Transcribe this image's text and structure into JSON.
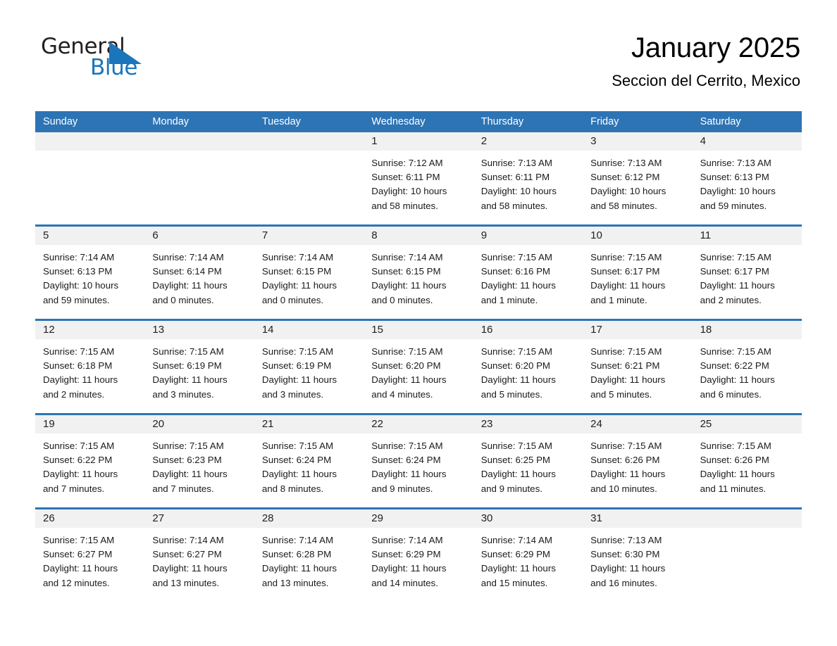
{
  "brand": {
    "name_part1": "General",
    "name_part2": "Blue",
    "logo_icon": "triangle-logo-icon",
    "accent_color": "#1b75bb"
  },
  "header": {
    "month_title": "January 2025",
    "location": "Seccion del Cerrito, Mexico"
  },
  "colors": {
    "header_blue": "#2d74b5",
    "daynum_strip": "#f1f1f1",
    "cell_background": "#ffffff",
    "text": "#1a1a1a"
  },
  "weekdays": [
    "Sunday",
    "Monday",
    "Tuesday",
    "Wednesday",
    "Thursday",
    "Friday",
    "Saturday"
  ],
  "weeks": [
    [
      {
        "day": "",
        "lines": []
      },
      {
        "day": "",
        "lines": []
      },
      {
        "day": "",
        "lines": []
      },
      {
        "day": "1",
        "lines": [
          "Sunrise: 7:12 AM",
          "Sunset: 6:11 PM",
          "Daylight: 10 hours",
          "and 58 minutes."
        ]
      },
      {
        "day": "2",
        "lines": [
          "Sunrise: 7:13 AM",
          "Sunset: 6:11 PM",
          "Daylight: 10 hours",
          "and 58 minutes."
        ]
      },
      {
        "day": "3",
        "lines": [
          "Sunrise: 7:13 AM",
          "Sunset: 6:12 PM",
          "Daylight: 10 hours",
          "and 58 minutes."
        ]
      },
      {
        "day": "4",
        "lines": [
          "Sunrise: 7:13 AM",
          "Sunset: 6:13 PM",
          "Daylight: 10 hours",
          "and 59 minutes."
        ]
      }
    ],
    [
      {
        "day": "5",
        "lines": [
          "Sunrise: 7:14 AM",
          "Sunset: 6:13 PM",
          "Daylight: 10 hours",
          "and 59 minutes."
        ]
      },
      {
        "day": "6",
        "lines": [
          "Sunrise: 7:14 AM",
          "Sunset: 6:14 PM",
          "Daylight: 11 hours",
          "and 0 minutes."
        ]
      },
      {
        "day": "7",
        "lines": [
          "Sunrise: 7:14 AM",
          "Sunset: 6:15 PM",
          "Daylight: 11 hours",
          "and 0 minutes."
        ]
      },
      {
        "day": "8",
        "lines": [
          "Sunrise: 7:14 AM",
          "Sunset: 6:15 PM",
          "Daylight: 11 hours",
          "and 0 minutes."
        ]
      },
      {
        "day": "9",
        "lines": [
          "Sunrise: 7:15 AM",
          "Sunset: 6:16 PM",
          "Daylight: 11 hours",
          "and 1 minute."
        ]
      },
      {
        "day": "10",
        "lines": [
          "Sunrise: 7:15 AM",
          "Sunset: 6:17 PM",
          "Daylight: 11 hours",
          "and 1 minute."
        ]
      },
      {
        "day": "11",
        "lines": [
          "Sunrise: 7:15 AM",
          "Sunset: 6:17 PM",
          "Daylight: 11 hours",
          "and 2 minutes."
        ]
      }
    ],
    [
      {
        "day": "12",
        "lines": [
          "Sunrise: 7:15 AM",
          "Sunset: 6:18 PM",
          "Daylight: 11 hours",
          "and 2 minutes."
        ]
      },
      {
        "day": "13",
        "lines": [
          "Sunrise: 7:15 AM",
          "Sunset: 6:19 PM",
          "Daylight: 11 hours",
          "and 3 minutes."
        ]
      },
      {
        "day": "14",
        "lines": [
          "Sunrise: 7:15 AM",
          "Sunset: 6:19 PM",
          "Daylight: 11 hours",
          "and 3 minutes."
        ]
      },
      {
        "day": "15",
        "lines": [
          "Sunrise: 7:15 AM",
          "Sunset: 6:20 PM",
          "Daylight: 11 hours",
          "and 4 minutes."
        ]
      },
      {
        "day": "16",
        "lines": [
          "Sunrise: 7:15 AM",
          "Sunset: 6:20 PM",
          "Daylight: 11 hours",
          "and 5 minutes."
        ]
      },
      {
        "day": "17",
        "lines": [
          "Sunrise: 7:15 AM",
          "Sunset: 6:21 PM",
          "Daylight: 11 hours",
          "and 5 minutes."
        ]
      },
      {
        "day": "18",
        "lines": [
          "Sunrise: 7:15 AM",
          "Sunset: 6:22 PM",
          "Daylight: 11 hours",
          "and 6 minutes."
        ]
      }
    ],
    [
      {
        "day": "19",
        "lines": [
          "Sunrise: 7:15 AM",
          "Sunset: 6:22 PM",
          "Daylight: 11 hours",
          "and 7 minutes."
        ]
      },
      {
        "day": "20",
        "lines": [
          "Sunrise: 7:15 AM",
          "Sunset: 6:23 PM",
          "Daylight: 11 hours",
          "and 7 minutes."
        ]
      },
      {
        "day": "21",
        "lines": [
          "Sunrise: 7:15 AM",
          "Sunset: 6:24 PM",
          "Daylight: 11 hours",
          "and 8 minutes."
        ]
      },
      {
        "day": "22",
        "lines": [
          "Sunrise: 7:15 AM",
          "Sunset: 6:24 PM",
          "Daylight: 11 hours",
          "and 9 minutes."
        ]
      },
      {
        "day": "23",
        "lines": [
          "Sunrise: 7:15 AM",
          "Sunset: 6:25 PM",
          "Daylight: 11 hours",
          "and 9 minutes."
        ]
      },
      {
        "day": "24",
        "lines": [
          "Sunrise: 7:15 AM",
          "Sunset: 6:26 PM",
          "Daylight: 11 hours",
          "and 10 minutes."
        ]
      },
      {
        "day": "25",
        "lines": [
          "Sunrise: 7:15 AM",
          "Sunset: 6:26 PM",
          "Daylight: 11 hours",
          "and 11 minutes."
        ]
      }
    ],
    [
      {
        "day": "26",
        "lines": [
          "Sunrise: 7:15 AM",
          "Sunset: 6:27 PM",
          "Daylight: 11 hours",
          "and 12 minutes."
        ]
      },
      {
        "day": "27",
        "lines": [
          "Sunrise: 7:14 AM",
          "Sunset: 6:27 PM",
          "Daylight: 11 hours",
          "and 13 minutes."
        ]
      },
      {
        "day": "28",
        "lines": [
          "Sunrise: 7:14 AM",
          "Sunset: 6:28 PM",
          "Daylight: 11 hours",
          "and 13 minutes."
        ]
      },
      {
        "day": "29",
        "lines": [
          "Sunrise: 7:14 AM",
          "Sunset: 6:29 PM",
          "Daylight: 11 hours",
          "and 14 minutes."
        ]
      },
      {
        "day": "30",
        "lines": [
          "Sunrise: 7:14 AM",
          "Sunset: 6:29 PM",
          "Daylight: 11 hours",
          "and 15 minutes."
        ]
      },
      {
        "day": "31",
        "lines": [
          "Sunrise: 7:13 AM",
          "Sunset: 6:30 PM",
          "Daylight: 11 hours",
          "and 16 minutes."
        ]
      },
      {
        "day": "",
        "lines": []
      }
    ]
  ]
}
